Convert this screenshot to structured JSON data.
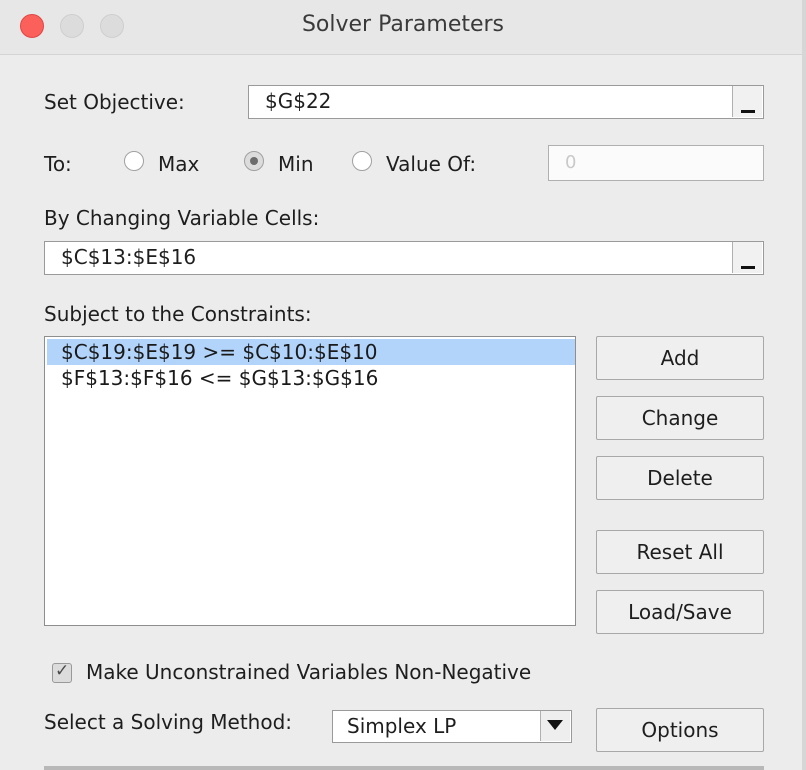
{
  "window": {
    "title": "Solver Parameters"
  },
  "objective": {
    "label": "Set Objective:",
    "value": "$G$22"
  },
  "to": {
    "label": "To:",
    "options": [
      "Max",
      "Min",
      "Value Of:"
    ],
    "selected": "Min",
    "value_of_value": "0"
  },
  "changing": {
    "label": "By Changing Variable Cells:",
    "value": "$C$13:$E$16"
  },
  "constraints": {
    "label": "Subject to the Constraints:",
    "items": [
      "$C$19:$E$19 >= $C$10:$E$10",
      "$F$13:$F$16 <= $G$13:$G$16"
    ],
    "selected_index": 0
  },
  "buttons": {
    "add": "Add",
    "change": "Change",
    "delete": "Delete",
    "reset_all": "Reset All",
    "load_save": "Load/Save",
    "options": "Options"
  },
  "nonneg": {
    "label": "Make Unconstrained Variables Non-Negative",
    "checked": true
  },
  "method": {
    "label": "Select a Solving Method:",
    "value": "Simplex LP"
  },
  "colors": {
    "close": "#fc605b",
    "selection": "#b2d4fb"
  }
}
